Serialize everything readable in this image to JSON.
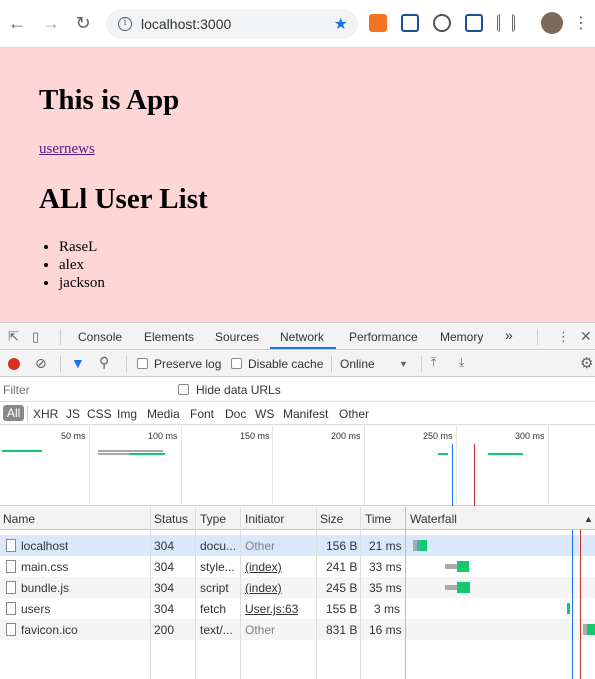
{
  "browser": {
    "url": "localhost:3000"
  },
  "page": {
    "title": "This is App",
    "link": "usernews",
    "list_heading": "ALl User List",
    "users": [
      "RaseL",
      "alex",
      "jackson"
    ]
  },
  "devtools": {
    "tabs": [
      "Console",
      "Elements",
      "Sources",
      "Network",
      "Performance",
      "Memory"
    ],
    "active_tab": "Network",
    "more": "»",
    "toolbar": {
      "preserve_log": "Preserve log",
      "disable_cache": "Disable cache",
      "throttle": "Online"
    },
    "filter": {
      "placeholder": "Filter",
      "hide_data_urls": "Hide data URLs"
    },
    "types": [
      "All",
      "XHR",
      "JS",
      "CSS",
      "Img",
      "Media",
      "Font",
      "Doc",
      "WS",
      "Manifest",
      "Other"
    ],
    "overview_ticks": [
      "50 ms",
      "100 ms",
      "150 ms",
      "200 ms",
      "250 ms",
      "300 ms"
    ],
    "columns": [
      "Name",
      "Status",
      "Type",
      "Initiator",
      "Size",
      "Time",
      "Waterfall"
    ],
    "rows": [
      {
        "name": "localhost",
        "status": "304",
        "type": "docu...",
        "initiator": "Other",
        "size": "156 B",
        "time": "21 ms"
      },
      {
        "name": "main.css",
        "status": "304",
        "type": "style...",
        "initiator": "(index)",
        "size": "241 B",
        "time": "33 ms"
      },
      {
        "name": "bundle.js",
        "status": "304",
        "type": "script",
        "initiator": "(index)",
        "size": "245 B",
        "time": "35 ms"
      },
      {
        "name": "users",
        "status": "304",
        "type": "fetch",
        "initiator": "User.js:63",
        "size": "155 B",
        "time": "3 ms"
      },
      {
        "name": "favicon.ico",
        "status": "200",
        "type": "text/...",
        "initiator": "Other",
        "size": "831 B",
        "time": "16 ms"
      }
    ]
  },
  "colors": {
    "page_bg": "#ffd6d6",
    "accent": "#1a73e8",
    "record": "#d93025",
    "waterfall_green": "#13c96b"
  }
}
